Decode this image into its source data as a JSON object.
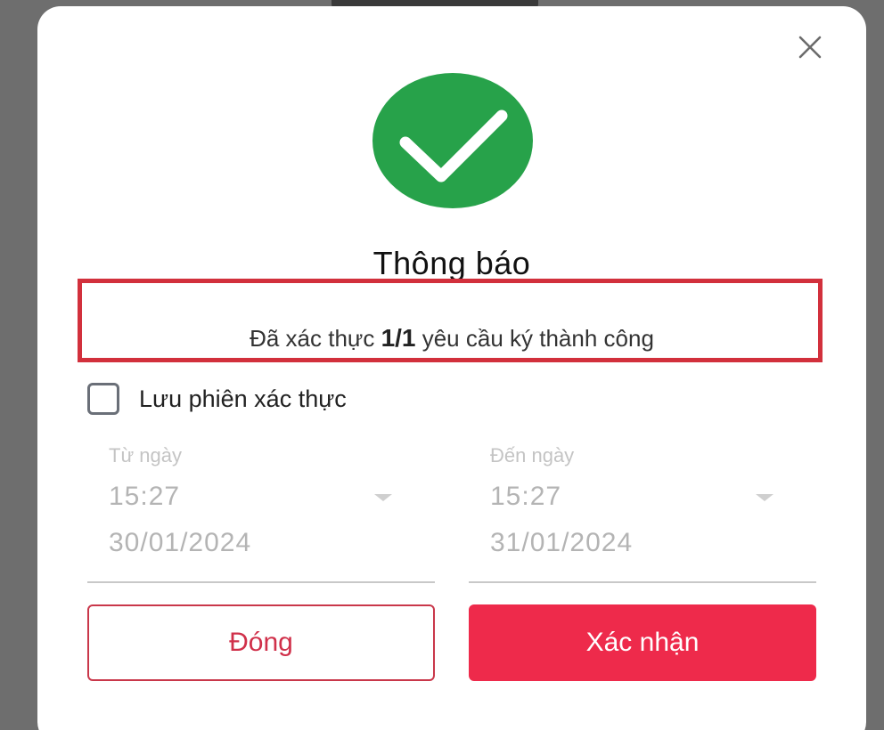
{
  "dialog": {
    "title": "Thông báo",
    "message_prefix": "Đã xác thực ",
    "message_count": "1/1",
    "message_suffix": " yêu cầu ký thành công",
    "close_icon": "close-icon",
    "status_icon": "check-circle-icon",
    "status_color": "#27a24a",
    "highlight_color": "#d2303c"
  },
  "save_session": {
    "label": "Lưu phiên xác thực",
    "checked": false
  },
  "from_date": {
    "label": "Từ ngày",
    "time": "15:27",
    "date": "30/01/2024"
  },
  "to_date": {
    "label": "Đến ngày",
    "time": "15:27",
    "date": "31/01/2024"
  },
  "buttons": {
    "close_label": "Đóng",
    "confirm_label": "Xác nhận",
    "accent_color": "#ee2a4b"
  }
}
